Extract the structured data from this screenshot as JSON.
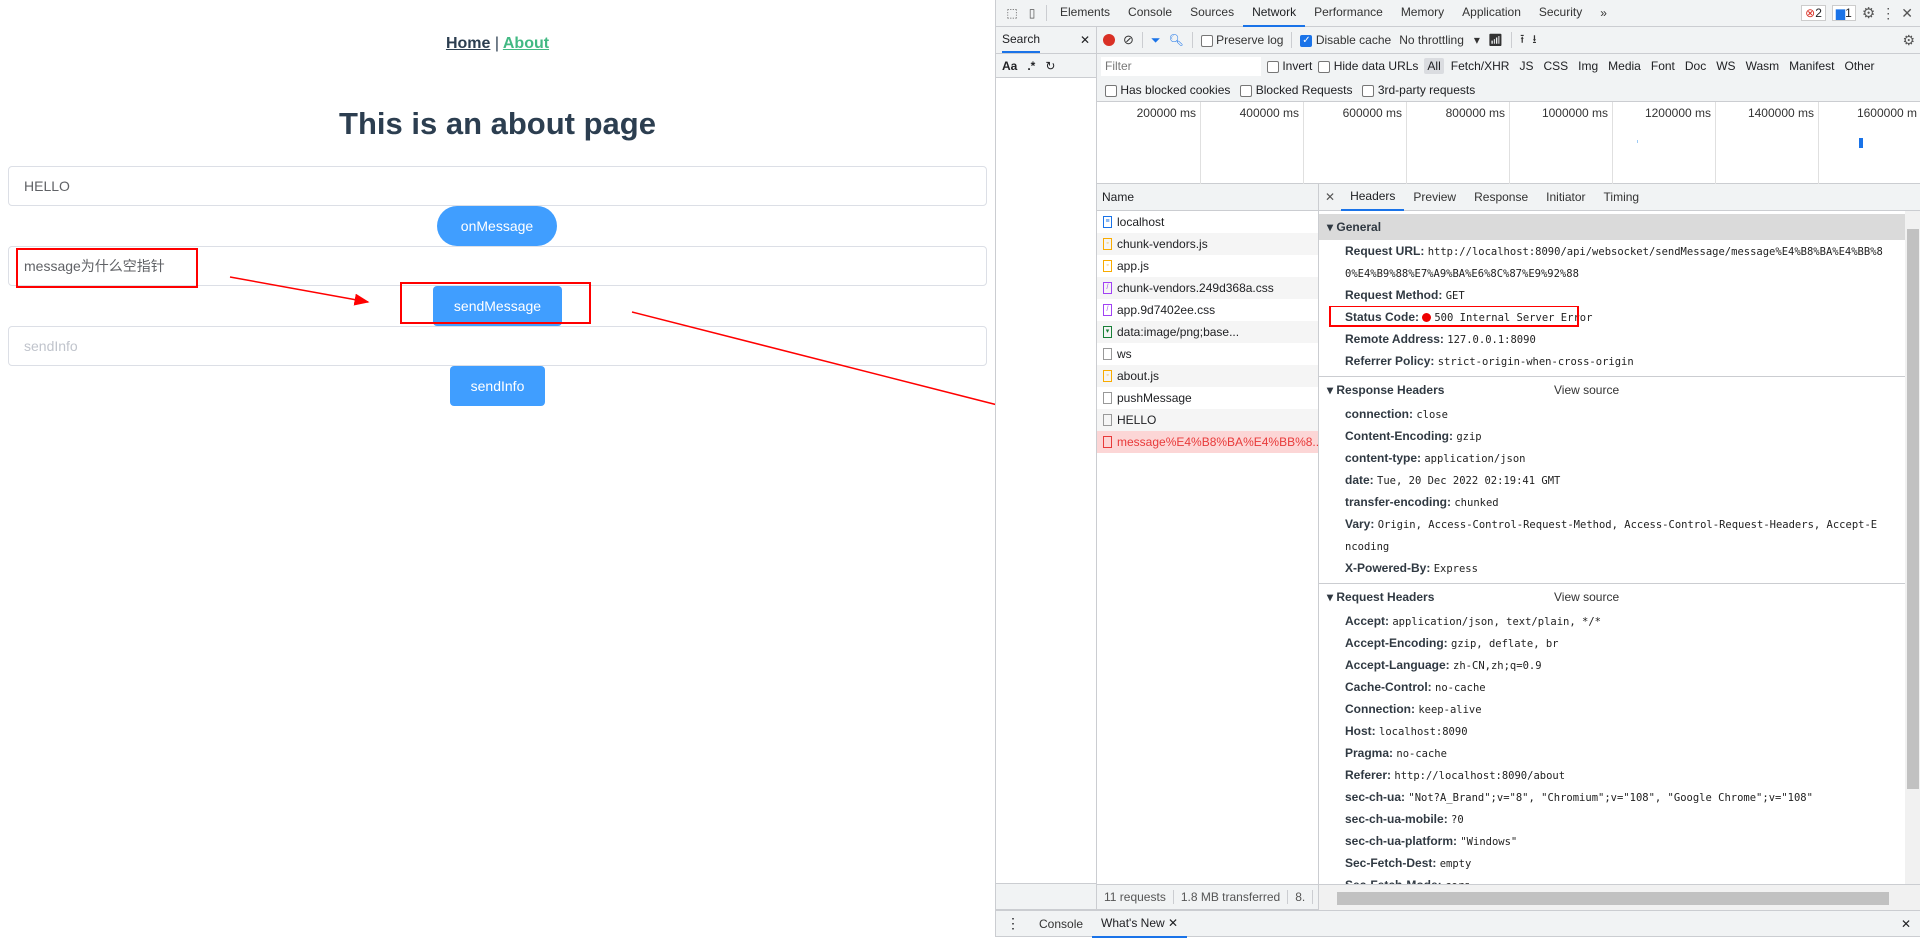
{
  "page": {
    "nav": {
      "home": "Home",
      "sep": "|",
      "about": "About"
    },
    "title": "This is an about page",
    "input1_value": "HELLO",
    "on_message_label": "onMessage",
    "input2_value": "message为什么空指针",
    "send_message_label": "sendMessage",
    "input3_placeholder": "sendInfo",
    "send_info_label": "sendInfo",
    "annotation_color": "#ff0000",
    "button_color": "#409eff"
  },
  "devtools": {
    "tabs": [
      "Elements",
      "Console",
      "Sources",
      "Network",
      "Performance",
      "Memory",
      "Application",
      "Security"
    ],
    "active_tab": "Network",
    "more": "»",
    "error_count": "2",
    "message_count": "1",
    "search_tab": "Search",
    "search_opts": [
      "Aa",
      ".*"
    ],
    "toolbar": {
      "preserve_log": "Preserve log",
      "disable_cache": "Disable cache",
      "disable_cache_checked": true,
      "preserve_log_checked": false,
      "throttling": "No throttling"
    },
    "filter_placeholder": "Filter",
    "invert": "Invert",
    "hide_data_urls": "Hide data URLs",
    "filter_types": [
      "All",
      "Fetch/XHR",
      "JS",
      "CSS",
      "Img",
      "Media",
      "Font",
      "Doc",
      "WS",
      "Wasm",
      "Manifest",
      "Other"
    ],
    "more_filters": [
      "Has blocked cookies",
      "Blocked Requests",
      "3rd-party requests"
    ],
    "timeline_ticks": [
      "200000 ms",
      "400000 ms",
      "600000 ms",
      "800000 ms",
      "1000000 ms",
      "1200000 ms",
      "1400000 ms",
      "1600000 m"
    ],
    "name_header": "Name",
    "requests": [
      {
        "name": "localhost",
        "icon": "document-icon"
      },
      {
        "name": "chunk-vendors.js",
        "icon": "script-icon"
      },
      {
        "name": "app.js",
        "icon": "script-icon"
      },
      {
        "name": "chunk-vendors.249d368a.css",
        "icon": "stylesheet-icon"
      },
      {
        "name": "app.9d7402ee.css",
        "icon": "stylesheet-icon"
      },
      {
        "name": "data:image/png;base...",
        "icon": "image-icon"
      },
      {
        "name": "ws",
        "icon": "generic-file-icon"
      },
      {
        "name": "about.js",
        "icon": "script-icon"
      },
      {
        "name": "pushMessage",
        "icon": "generic-file-icon"
      },
      {
        "name": "HELLO",
        "icon": "generic-file-icon"
      },
      {
        "name": "message%E4%B8%BA%E4%BB%8...",
        "icon": "generic-file-icon",
        "error": true
      }
    ],
    "status_bar": [
      "11 requests",
      "1.8 MB transferred",
      "8."
    ],
    "detail_tabs": [
      "Headers",
      "Preview",
      "Response",
      "Initiator",
      "Timing"
    ],
    "active_detail_tab": "Headers",
    "general": {
      "title": "General",
      "items": [
        {
          "k": "Request URL:",
          "v": "http://localhost:8090/api/websocket/sendMessage/message%E4%B8%BA%E4%BB%8"
        },
        {
          "k": "",
          "v": "0%E4%B9%88%E7%A9%BA%E6%8C%87%E9%92%88"
        },
        {
          "k": "Request Method:",
          "v": "GET"
        },
        {
          "k": "Status Code:",
          "v": "500 Internal Server Error",
          "status": true
        },
        {
          "k": "Remote Address:",
          "v": "127.0.0.1:8090"
        },
        {
          "k": "Referrer Policy:",
          "v": "strict-origin-when-cross-origin"
        }
      ]
    },
    "response_headers": {
      "title": "Response Headers",
      "view_source": "View source",
      "items": [
        {
          "k": "connection:",
          "v": "close"
        },
        {
          "k": "Content-Encoding:",
          "v": "gzip"
        },
        {
          "k": "content-type:",
          "v": "application/json"
        },
        {
          "k": "date:",
          "v": "Tue, 20 Dec 2022 02:19:41 GMT"
        },
        {
          "k": "transfer-encoding:",
          "v": "chunked"
        },
        {
          "k": "Vary:",
          "v": "Origin, Access-Control-Request-Method, Access-Control-Request-Headers, Accept-E"
        },
        {
          "k": "",
          "v": "ncoding"
        },
        {
          "k": "X-Powered-By:",
          "v": "Express"
        }
      ]
    },
    "request_headers": {
      "title": "Request Headers",
      "view_source": "View source",
      "items": [
        {
          "k": "Accept:",
          "v": "application/json, text/plain, */*"
        },
        {
          "k": "Accept-Encoding:",
          "v": "gzip, deflate, br"
        },
        {
          "k": "Accept-Language:",
          "v": "zh-CN,zh;q=0.9"
        },
        {
          "k": "Cache-Control:",
          "v": "no-cache"
        },
        {
          "k": "Connection:",
          "v": "keep-alive"
        },
        {
          "k": "Host:",
          "v": "localhost:8090"
        },
        {
          "k": "Pragma:",
          "v": "no-cache"
        },
        {
          "k": "Referer:",
          "v": "http://localhost:8090/about"
        },
        {
          "k": "sec-ch-ua:",
          "v": "\"Not?A_Brand\";v=\"8\", \"Chromium\";v=\"108\", \"Google Chrome\";v=\"108\""
        },
        {
          "k": "sec-ch-ua-mobile:",
          "v": "?0"
        },
        {
          "k": "sec-ch-ua-platform:",
          "v": "\"Windows\""
        },
        {
          "k": "Sec-Fetch-Dest:",
          "v": "empty"
        },
        {
          "k": "Sec-Fetch-Mode:",
          "v": "cors"
        }
      ]
    },
    "drawer_tabs": [
      "Console",
      "What's New"
    ],
    "active_drawer_tab": "What's New"
  }
}
